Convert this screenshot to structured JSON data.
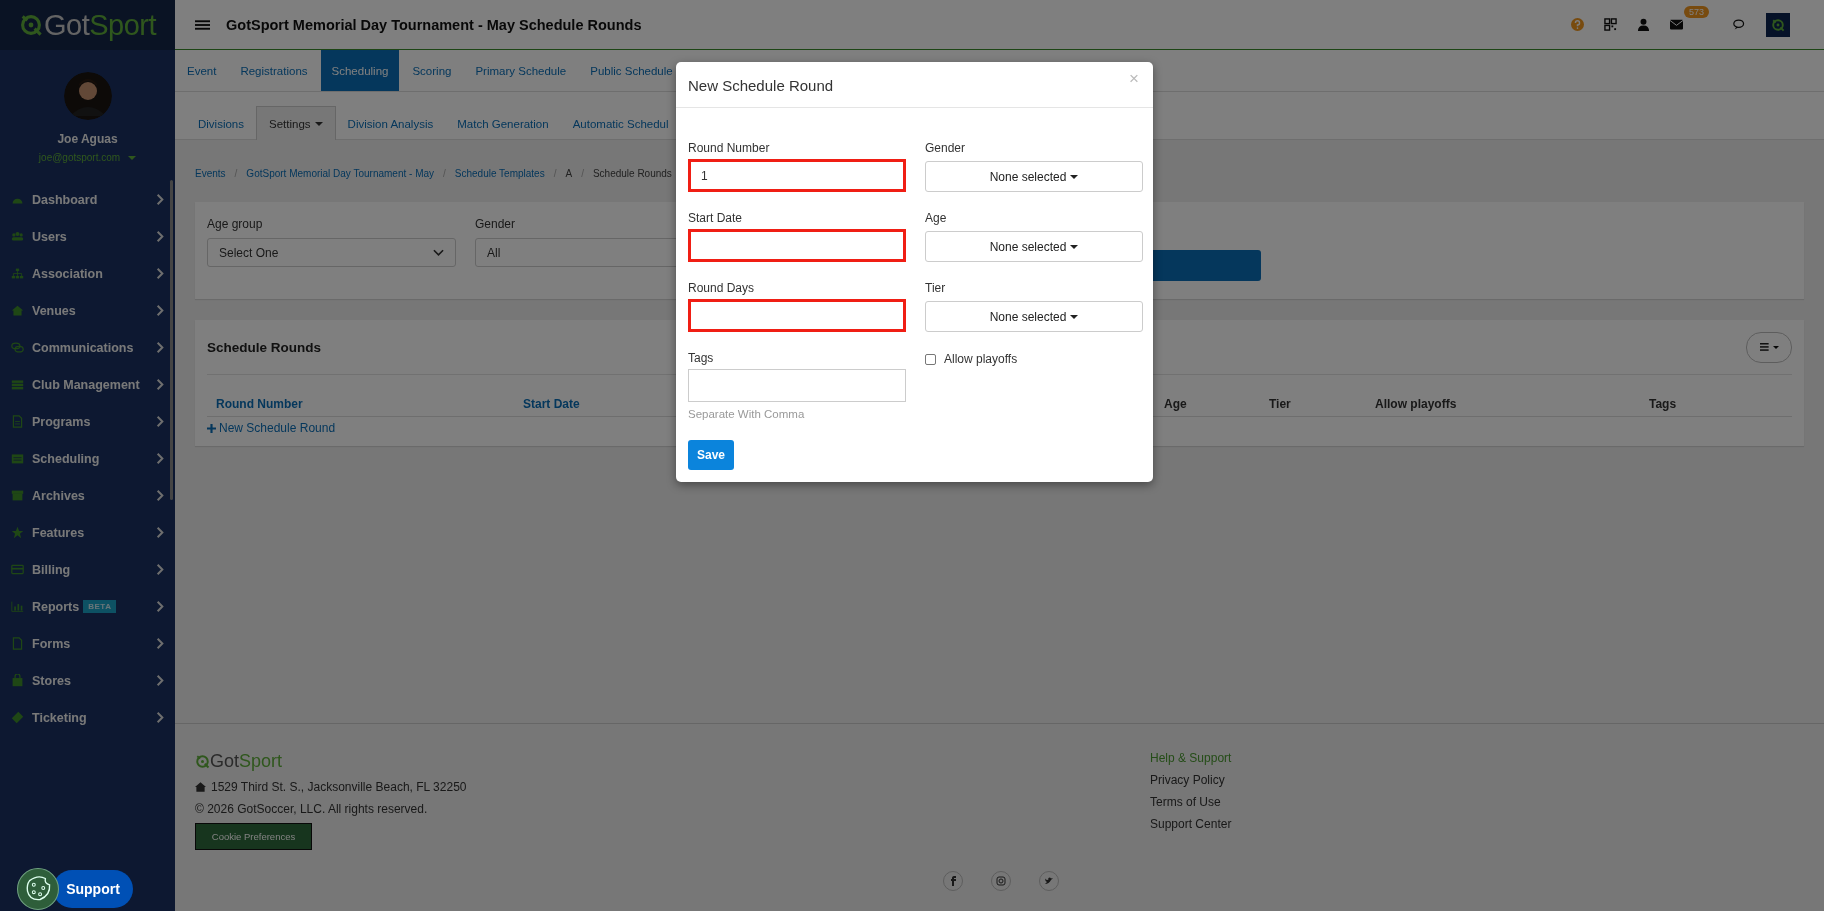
{
  "topbar": {
    "title": "GotSport Memorial Day Tournament - May Schedule Rounds",
    "mail_badge": "573"
  },
  "sidebar": {
    "logo": [
      "Got",
      "Sport"
    ],
    "user": {
      "name": "Joe Aguas",
      "email": "joe@gotsport.com"
    },
    "menu": [
      {
        "label": "Dashboard"
      },
      {
        "label": "Users"
      },
      {
        "label": "Association"
      },
      {
        "label": "Venues"
      },
      {
        "label": "Communications"
      },
      {
        "label": "Club Management"
      },
      {
        "label": "Programs"
      },
      {
        "label": "Scheduling"
      },
      {
        "label": "Archives"
      },
      {
        "label": "Features"
      },
      {
        "label": "Billing"
      },
      {
        "label": "Reports",
        "badge": "BETA"
      },
      {
        "label": "Forms"
      },
      {
        "label": "Stores"
      },
      {
        "label": "Ticketing"
      }
    ]
  },
  "tabs": [
    {
      "label": "Event",
      "selected": false
    },
    {
      "label": "Registrations",
      "selected": false
    },
    {
      "label": "Scheduling",
      "selected": true
    },
    {
      "label": "Scoring",
      "selected": false
    },
    {
      "label": "Primary Schedule",
      "selected": false
    },
    {
      "label": "Public Schedule",
      "selected": false
    }
  ],
  "subtabs": [
    {
      "label": "Divisions",
      "selected": false,
      "dropdown": false
    },
    {
      "label": "Settings",
      "selected": true,
      "dropdown": true
    },
    {
      "label": "Division Analysis",
      "selected": false,
      "dropdown": false
    },
    {
      "label": "Match Generation",
      "selected": false,
      "dropdown": false
    },
    {
      "label": "Automatic Schedul",
      "selected": false,
      "dropdown": false
    }
  ],
  "breadcrumb": {
    "separator": "/",
    "items": [
      {
        "label": "Events",
        "link": true
      },
      {
        "label": "GotSport Memorial Day Tournament - May",
        "link": true
      },
      {
        "label": "Schedule Templates",
        "link": true
      },
      {
        "label": "A",
        "link": false
      },
      {
        "label": "Schedule Rounds",
        "link": false
      }
    ]
  },
  "filters": [
    {
      "label": "Age group",
      "value": "Select One"
    },
    {
      "label": "Gender",
      "value": "All"
    }
  ],
  "schedule_rounds": {
    "title": "Schedule Rounds",
    "columns": [
      "Round Number",
      "Start Date",
      "Age",
      "Tier",
      "Allow playoffs",
      "Tags"
    ],
    "add_link": "New Schedule Round"
  },
  "footer": {
    "logo": [
      "Got",
      "Sport"
    ],
    "address": "1529 Third St. S., Jacksonville Beach, FL 32250",
    "copyright": "© 2026 GotSoccer, LLC. All rights reserved.",
    "cookie_button": "Cookie Preferences",
    "help_title": "Help & Support",
    "links": [
      "Privacy Policy",
      "Terms of Use",
      "Support Center"
    ]
  },
  "support_button": "Support",
  "modal": {
    "title": "New Schedule Round",
    "close": "×",
    "save": "Save",
    "fields": [
      {
        "kind": "text",
        "label": "Round Number",
        "value": "1",
        "error": true
      },
      {
        "kind": "dropdown",
        "label": "Gender",
        "value": "None selected"
      },
      {
        "kind": "text",
        "label": "Start Date",
        "error": true
      },
      {
        "kind": "dropdown",
        "label": "Age",
        "value": "None selected"
      },
      {
        "kind": "text",
        "label": "Round Days",
        "error": true
      },
      {
        "kind": "dropdown",
        "label": "Tier",
        "value": "None selected"
      },
      {
        "kind": "text",
        "label": "Tags",
        "help": "Separate With Comma",
        "error": false
      },
      {
        "kind": "checkbox",
        "label": "Allow playoffs",
        "checked": false
      }
    ]
  }
}
